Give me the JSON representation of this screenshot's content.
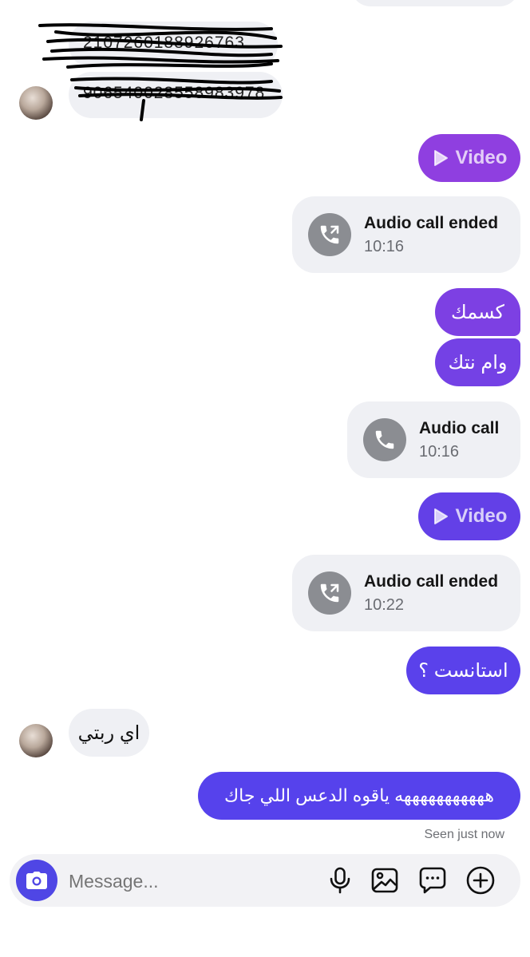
{
  "incoming_top": {
    "redacted_line_1": "2107260188926763",
    "redacted_line_2": "906540028558983978"
  },
  "messages": {
    "video_1": "Video",
    "call_1": {
      "title": "Audio call ended",
      "time": "10:16"
    },
    "text_1": "كسمك",
    "text_2": "وام نتك",
    "call_2": {
      "title": "Audio call",
      "time": "10:16"
    },
    "video_2": "Video",
    "call_3": {
      "title": "Audio call ended",
      "time": "10:22"
    },
    "text_3": "استانست ؟",
    "incoming_1": "اي ربتي",
    "text_4": "هههههههههههه ياقوه الدعس اللي جاك",
    "seen": "Seen just now"
  },
  "composer": {
    "placeholder": "Message..."
  },
  "colors": {
    "purple_top": "#8f3fe0",
    "purple_mid": "#6a3fe6",
    "purple_bottom": "#5642ec",
    "incoming_bg": "#eff0f4"
  },
  "icons": [
    "camera-icon",
    "microphone-icon",
    "image-icon",
    "sticker-icon",
    "plus-icon",
    "phone-icon",
    "phone-outgoing-icon",
    "play-icon"
  ]
}
